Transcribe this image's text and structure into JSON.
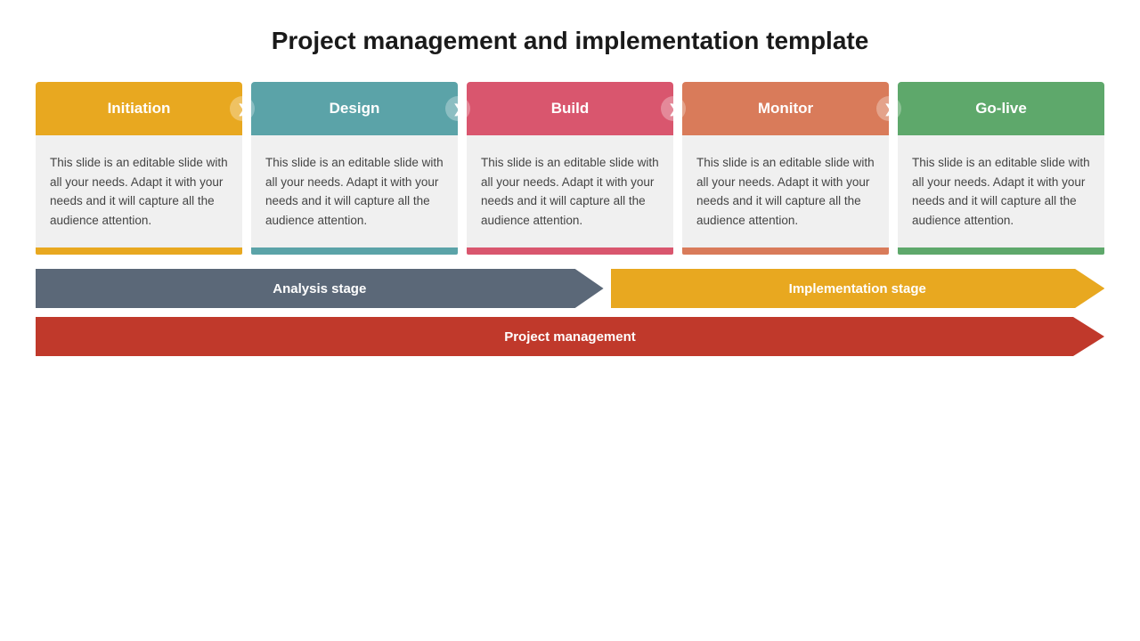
{
  "title": "Project management and implementation template",
  "columns": [
    {
      "id": "initiation",
      "label": "Initiation",
      "color": "#E8A820",
      "body_text": "This slide is an editable slide with all your needs. Adapt it with your needs and it will capture all the audience attention."
    },
    {
      "id": "design",
      "label": "Design",
      "color": "#5BA3A8",
      "body_text": "This slide is an editable slide with all your needs. Adapt it with your needs and it will capture all the audience attention."
    },
    {
      "id": "build",
      "label": "Build",
      "color": "#D9566E",
      "body_text": "This slide is an editable slide with all your needs. Adapt it with your needs and it will capture all the audience attention."
    },
    {
      "id": "monitor",
      "label": "Monitor",
      "color": "#D97B5A",
      "body_text": "This slide is an editable slide with all your needs. Adapt it with your needs and it will capture all the audience attention."
    },
    {
      "id": "golive",
      "label": "Go-live",
      "color": "#5EA86B",
      "body_text": "This slide is an editable slide with all your needs. Adapt it with your needs and it will capture all the audience attention."
    }
  ],
  "stages": {
    "analysis": {
      "label": "Analysis stage",
      "color": "#5B6878"
    },
    "implementation": {
      "label": "Implementation stage",
      "color": "#E8A820"
    }
  },
  "project_management": {
    "label": "Project management",
    "color": "#C0392B"
  },
  "arrow_icon": "❯"
}
